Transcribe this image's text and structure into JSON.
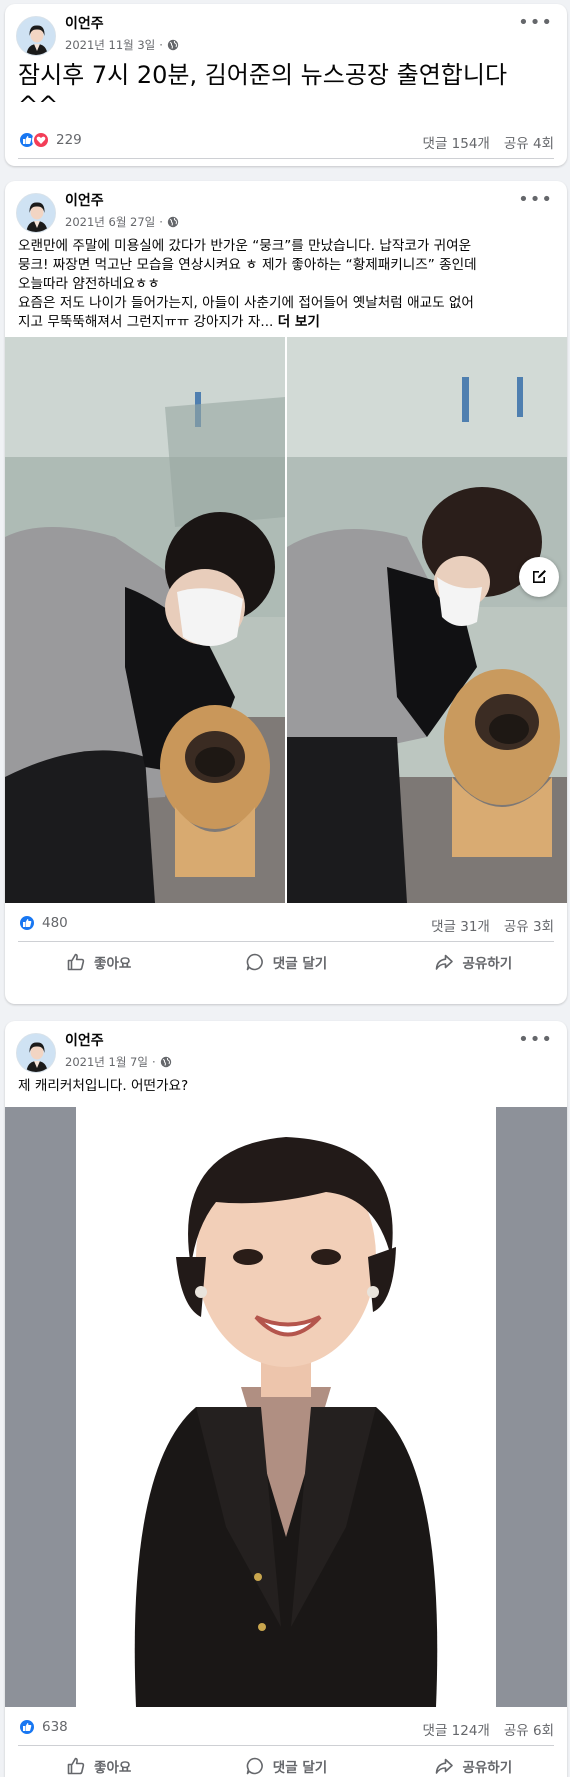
{
  "author": "이언주",
  "actions": {
    "like": "좋아요",
    "comment": "댓글 달기",
    "share": "공유하기"
  },
  "posts": [
    {
      "date": "2021년 11월 3일",
      "text": "잠시후 7시 20분, 김어준의 뉴스공장 출연합니다 ^^",
      "reactions": "229",
      "comments": "댓글 154개",
      "shares": "공유 4회"
    },
    {
      "date": "2021년 6월 27일",
      "text_lines": [
        "오랜만에 주말에 미용실에 갔다가 반가운 “뭉크”를 만났습니다. 납작코가 귀여운",
        "뭉크! 짜장면 먹고난 모습을 연상시켜요 ㅎ 제가 좋아하는 “황제패키니즈” 종인데",
        "오늘따라 얌전하네요ㅎㅎ",
        "요즘은 저도 나이가 들어가는지, 아들이 사춘기에 접어들어 옛날처럼 애교도 없어",
        "지고 무뚝뚝해져서 그런지ㅠㅠ 강아지가 자..."
      ],
      "see_more": "더 보기",
      "reactions": "480",
      "comments": "댓글 31개",
      "shares": "공유 3회"
    },
    {
      "date": "2021년 1월 7일",
      "text": "제 캐리커처입니다. 어떤가요?",
      "reactions": "638",
      "comments": "댓글 124개",
      "shares": "공유 6회"
    }
  ],
  "colors": {
    "like": "#1877f2",
    "love": "#f33e58",
    "muted": "#65676b",
    "bg": "#f0f2f5"
  },
  "icons": [
    "like-reaction-icon",
    "love-reaction-icon",
    "globe-icon",
    "more-icon",
    "like-icon",
    "comment-icon",
    "share-icon",
    "edit-icon"
  ]
}
